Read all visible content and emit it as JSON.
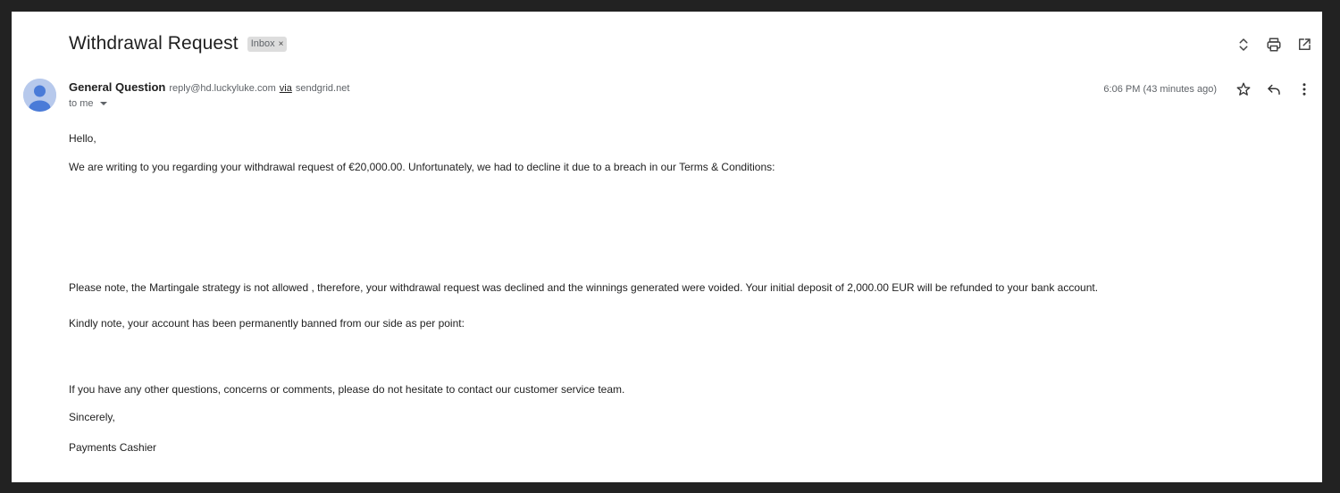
{
  "email": {
    "subject": "Withdrawal Request",
    "label": "Inbox",
    "label_close": "×",
    "sender_name": "General Question",
    "sender_email": "reply@hd.luckyluke.com",
    "via_text": "via",
    "via_domain": "sendgrid.net",
    "recipient": "to me",
    "timestamp": "6:06 PM (43 minutes ago)"
  },
  "icons": {
    "top_actions": [
      "expand-collapse-icon",
      "print-icon",
      "open-new-window-icon"
    ],
    "message_actions": [
      "star-icon",
      "reply-icon",
      "more-vert-icon"
    ]
  },
  "body": {
    "greeting": "Hello,",
    "paragraph1": "We are writing to you regarding your withdrawal request of €20,000.00. Unfortunately, we had to decline it due to a breach in our Terms & Conditions:",
    "paragraph2": "Please note, the Martingale strategy is not allowed , therefore, your withdrawal request was declined and the winnings generated were voided. Your initial deposit of 2,000.00 EUR will be refunded to your bank account.",
    "paragraph3": "Kindly note,  your account has been permanently banned from our side as per point:",
    "paragraph4": "If you have any other questions, concerns or comments, please do not hesitate to contact our customer service team.",
    "closing": "Sincerely,",
    "signature": "Payments Cashier"
  },
  "colors": {
    "background_outer": "#222222",
    "background_page": "#ffffff",
    "avatar_bg": "#b7c9ec",
    "avatar_fg": "#4a7bd8",
    "chip_bg": "#dddddd"
  }
}
